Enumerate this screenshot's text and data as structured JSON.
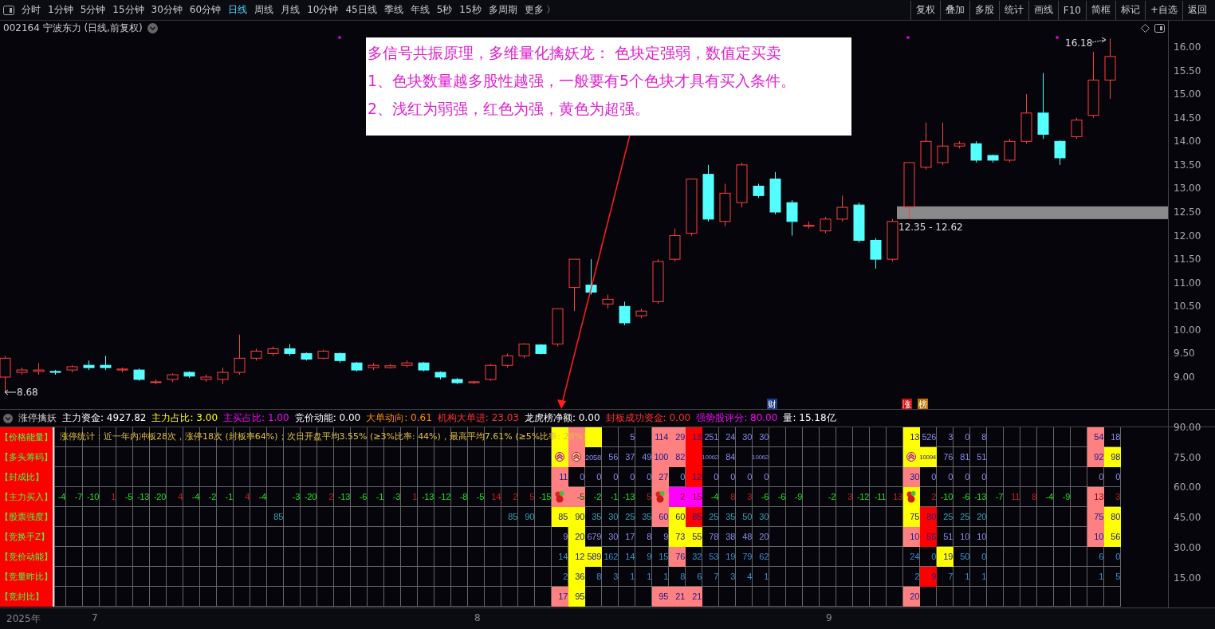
{
  "toolbar": {
    "periods": [
      {
        "label": "分时",
        "selected": false
      },
      {
        "label": "1分钟",
        "selected": false
      },
      {
        "label": "5分钟",
        "selected": false
      },
      {
        "label": "15分钟",
        "selected": false
      },
      {
        "label": "30分钟",
        "selected": false
      },
      {
        "label": "60分钟",
        "selected": false
      },
      {
        "label": "日线",
        "selected": true
      },
      {
        "label": "周线",
        "selected": false
      },
      {
        "label": "月线",
        "selected": false
      },
      {
        "label": "10分钟",
        "selected": false
      },
      {
        "label": "45日线",
        "selected": false
      },
      {
        "label": "季线",
        "selected": false
      },
      {
        "label": "年线",
        "selected": false
      },
      {
        "label": "5秒",
        "selected": false
      },
      {
        "label": "15秒",
        "selected": false
      },
      {
        "label": "多周期",
        "selected": false
      },
      {
        "label": "更多 〉",
        "selected": false
      }
    ],
    "actions": [
      "复权",
      "叠加",
      "多股",
      "统计",
      "画线",
      "F10",
      "简框",
      "标记",
      "+自选",
      "返回"
    ]
  },
  "chart": {
    "title": "002164 宁波东力 (日线,前复权)",
    "price_axis": [
      "16.00",
      "15.50",
      "15.00",
      "14.50",
      "14.00",
      "13.50",
      "13.00",
      "12.50",
      "12.00",
      "11.50",
      "11.00",
      "10.50",
      "10.00",
      "9.50",
      "9.00"
    ],
    "high_label": "16.18",
    "low_label": "8.68",
    "zone_label": "12.35 - 12.62",
    "badges": [
      {
        "text": "财",
        "color": "#1a3a8a"
      },
      {
        "text": "涨",
        "color": "#d01010"
      },
      {
        "text": "榜",
        "color": "#c07000"
      }
    ],
    "note": [
      "多信号共振原理，多维量化擒妖龙： 色块定强弱，数值定买卖",
      "1、色块数量越多股性越强，一般要有5个色块才具有买入条件。",
      "2、浅红为弱强，红色为强，黄色为超强。"
    ]
  },
  "indicator": {
    "name": "涨停擒妖",
    "values": [
      {
        "label": "主力资金:",
        "value": "4927.82",
        "color": "#ffffff"
      },
      {
        "label": "主力占比:",
        "value": "3.00",
        "color": "#ffff00"
      },
      {
        "label": "主买占比:",
        "value": "1.00",
        "color": "#ff00ff"
      },
      {
        "label": "竞价动能:",
        "value": "0.00",
        "color": "#ffffff"
      },
      {
        "label": "大单动向:",
        "value": "0.61",
        "color": "#ff8c00"
      },
      {
        "label": "机构大单进:",
        "value": "23.03",
        "color": "#ff3030"
      },
      {
        "label": "龙虎榜净额:",
        "value": "0.00",
        "color": "#ffffff"
      },
      {
        "label": "封板成功资金:",
        "value": "0.00",
        "color": "#ff3030"
      },
      {
        "label": "强势股评分:",
        "value": "80.00",
        "color": "#ff00ff"
      },
      {
        "label": "量:",
        "value": "15.18亿",
        "color": "#ffffff"
      }
    ]
  },
  "grid": {
    "summary": "涨停统计：近一年内冲板28次，涨停18次 (封板率64%)；次日开盘平均3.55% (≥3%比率: 44%)，最高平均7.61% (≥5%比率: 28%)",
    "axis": [
      "90.00",
      "75.00",
      "60.00",
      "45.00",
      "30.00",
      "15.00"
    ],
    "rows": [
      {
        "label": "【价格能量】",
        "cells": [
          null,
          null,
          null,
          null,
          null,
          null,
          null,
          null,
          null,
          null,
          null,
          null,
          null,
          null,
          null,
          null,
          null,
          null,
          null,
          null,
          null,
          null,
          null,
          null,
          null,
          null,
          null,
          null,
          null,
          null,
          {
            "color": "#ffff00"
          },
          {
            "color": "#ff8080"
          },
          {
            "color": "#ffff00"
          },
          null,
          {
            "text": "5"
          },
          null,
          {
            "text": "114",
            "color": "#ff8080"
          },
          {
            "text": "29",
            "color": "#ff8080"
          },
          {
            "text": "13",
            "color": "#ff0000"
          },
          {
            "text": "251"
          },
          {
            "text": "24"
          },
          {
            "text": "30"
          },
          {
            "text": "30"
          },
          null,
          null,
          null,
          null,
          null,
          null,
          null,
          null,
          {
            "text": "13",
            "color": "#ffff00"
          },
          {
            "text": "526"
          },
          {
            "text": "3"
          },
          {
            "text": "0"
          },
          {
            "text": "8"
          },
          null,
          null,
          null,
          null,
          null,
          null,
          {
            "text": "54",
            "color": "#ff8080"
          },
          {
            "text": "18"
          }
        ]
      },
      {
        "label": "【多头筹码】",
        "cells": [
          null,
          null,
          null,
          null,
          null,
          null,
          null,
          null,
          null,
          null,
          null,
          null,
          null,
          null,
          null,
          null,
          null,
          null,
          null,
          null,
          null,
          null,
          null,
          null,
          null,
          null,
          null,
          null,
          null,
          null,
          {
            "kind": "chevron",
            "color": "#ffff00"
          },
          {
            "kind": "chevron",
            "color": "#ff8080"
          },
          {
            "text": "2058"
          },
          {
            "text": "56"
          },
          {
            "text": "37"
          },
          {
            "text": "49"
          },
          {
            "text": "100",
            "color": "#ff8080"
          },
          {
            "text": "82",
            "color": "#ff8080"
          },
          {
            "color": "#ff0000"
          },
          {
            "text": "10062"
          },
          {
            "text": "84"
          },
          null,
          {
            "text": "10062"
          },
          null,
          null,
          null,
          null,
          null,
          null,
          null,
          null,
          {
            "kind": "chevron",
            "color": "#ffff00"
          },
          {
            "text": "10094",
            "color": "#ffff00"
          },
          {
            "text": "76"
          },
          {
            "text": "81"
          },
          {
            "text": "51"
          },
          null,
          null,
          null,
          null,
          null,
          null,
          {
            "text": "92",
            "color": "#ff8080"
          },
          {
            "text": "98",
            "color": "#ffff00"
          }
        ]
      },
      {
        "label": "【封成比】",
        "cells": [
          null,
          null,
          null,
          null,
          null,
          null,
          null,
          null,
          null,
          null,
          null,
          null,
          null,
          null,
          null,
          null,
          null,
          null,
          null,
          null,
          null,
          null,
          null,
          null,
          null,
          null,
          null,
          null,
          null,
          null,
          {
            "text": "11",
            "color": "#ff8080"
          },
          {
            "text": "0"
          },
          {
            "text": "0"
          },
          {
            "text": "0"
          },
          {
            "text": "0"
          },
          {
            "text": "0"
          },
          {
            "text": "27",
            "color": "#ff8080"
          },
          {
            "text": "0"
          },
          {
            "text": "12",
            "color": "#ff0000"
          },
          {
            "text": "0"
          },
          {
            "text": "0"
          },
          {
            "text": "0"
          },
          {
            "text": "0"
          },
          null,
          null,
          null,
          null,
          null,
          null,
          null,
          null,
          {
            "text": "30",
            "color": "#ff8080"
          },
          {
            "text": "0"
          },
          {
            "text": "0"
          },
          {
            "text": "0"
          },
          {
            "text": "0"
          },
          null,
          null,
          null,
          null,
          null,
          null,
          {
            "text": "0"
          },
          {
            "text": "0"
          }
        ]
      },
      {
        "label": "【主力买入】",
        "cells": [
          {
            "text": "-4",
            "kind": "fall"
          },
          {
            "text": "-7",
            "kind": "fall"
          },
          {
            "text": "-10",
            "kind": "fall"
          },
          {
            "text": "1",
            "kind": "rise"
          },
          {
            "text": "-5",
            "kind": "fall"
          },
          {
            "text": "-13",
            "kind": "fall"
          },
          {
            "text": "-20",
            "kind": "fall"
          },
          {
            "text": "4",
            "kind": "rise"
          },
          {
            "text": "-4",
            "kind": "fall"
          },
          {
            "text": "-2",
            "kind": "fall"
          },
          {
            "text": "-1",
            "kind": "fall"
          },
          {
            "text": "4",
            "kind": "rise"
          },
          {
            "text": "-4",
            "kind": "fall"
          },
          null,
          {
            "text": "-3",
            "kind": "fall"
          },
          {
            "text": "-20",
            "kind": "fall"
          },
          {
            "text": "2",
            "kind": "rise"
          },
          {
            "text": "-13",
            "kind": "fall"
          },
          {
            "text": "-6",
            "kind": "fall"
          },
          {
            "text": "-1",
            "kind": "fall"
          },
          {
            "text": "-3",
            "kind": "fall"
          },
          {
            "text": "1",
            "kind": "rise"
          },
          {
            "text": "-13",
            "kind": "fall"
          },
          {
            "text": "-12",
            "kind": "fall"
          },
          {
            "text": "-8",
            "kind": "fall"
          },
          {
            "text": "-5",
            "kind": "fall"
          },
          {
            "text": "14",
            "kind": "rise"
          },
          {
            "text": "2",
            "kind": "rise"
          },
          {
            "text": "5",
            "kind": "rise"
          },
          {
            "text": "-15",
            "kind": "fall"
          },
          {
            "kind": "fruit",
            "color": "#ff8080"
          },
          {
            "text": "-5",
            "kind": "fall",
            "color": "#ff8080"
          },
          {
            "text": "-2",
            "kind": "fall"
          },
          {
            "text": "-1",
            "kind": "fall"
          },
          {
            "text": "-13",
            "kind": "fall"
          },
          {
            "text": "5",
            "kind": "rise"
          },
          {
            "kind": "fruit",
            "color": "#ff8080"
          },
          {
            "text": "2",
            "kind": "rise",
            "color": "#ff00ff"
          },
          {
            "text": "15",
            "kind": "rise",
            "color": "#ff00ff"
          },
          {
            "text": "-4",
            "kind": "fall"
          },
          {
            "text": "8",
            "kind": "rise"
          },
          {
            "text": "3",
            "kind": "rise"
          },
          {
            "text": "-6",
            "kind": "fall"
          },
          {
            "text": "-6",
            "kind": "fall"
          },
          {
            "text": "-9",
            "kind": "fall"
          },
          null,
          {
            "text": "-2",
            "kind": "fall"
          },
          {
            "text": "3",
            "kind": "rise"
          },
          {
            "text": "-12",
            "kind": "fall"
          },
          {
            "text": "-11",
            "kind": "fall"
          },
          {
            "text": "13",
            "kind": "rise"
          },
          {
            "kind": "fruit",
            "color": "#ffff00"
          },
          {
            "text": "2",
            "kind": "rise"
          },
          {
            "text": "-10",
            "kind": "fall"
          },
          {
            "text": "-6",
            "kind": "fall"
          },
          {
            "text": "-13",
            "kind": "fall"
          },
          {
            "text": "-7",
            "kind": "fall"
          },
          {
            "text": "11",
            "kind": "rise"
          },
          {
            "text": "8",
            "kind": "rise"
          },
          {
            "text": "-4",
            "kind": "fall"
          },
          {
            "text": "-9",
            "kind": "fall"
          },
          null,
          {
            "text": "13",
            "kind": "rise",
            "color": "#ff8080"
          },
          {
            "text": "3",
            "kind": "rise"
          }
        ]
      },
      {
        "label": "【股票强度】",
        "cells": [
          null,
          null,
          null,
          null,
          null,
          null,
          null,
          null,
          null,
          null,
          null,
          null,
          null,
          {
            "text": "85"
          },
          null,
          null,
          null,
          null,
          null,
          null,
          null,
          null,
          null,
          null,
          null,
          null,
          null,
          {
            "text": "85"
          },
          {
            "text": "90"
          },
          null,
          {
            "text": "85",
            "color": "#ffff00"
          },
          {
            "text": "90",
            "color": "#ffff00"
          },
          {
            "text": "35"
          },
          {
            "text": "30"
          },
          {
            "text": "25"
          },
          {
            "text": "35"
          },
          {
            "text": "60",
            "color": "#ff8080"
          },
          {
            "text": "60",
            "color": "#ffff00"
          },
          {
            "text": "85",
            "color": "#ff0000"
          },
          {
            "text": "25"
          },
          {
            "text": "35"
          },
          {
            "text": "50"
          },
          {
            "text": "30"
          },
          null,
          null,
          null,
          null,
          null,
          null,
          null,
          null,
          {
            "text": "75",
            "color": "#ffff00"
          },
          {
            "text": "80",
            "color": "#ff0000"
          },
          {
            "text": "25"
          },
          {
            "text": "25"
          },
          {
            "text": "20"
          },
          null,
          null,
          null,
          null,
          null,
          null,
          {
            "text": "75",
            "color": "#ff8080"
          },
          {
            "text": "80",
            "color": "#ffff00"
          }
        ]
      },
      {
        "label": "【竞换手Z】",
        "cells": [
          null,
          null,
          null,
          null,
          null,
          null,
          null,
          null,
          null,
          null,
          null,
          null,
          null,
          null,
          null,
          null,
          null,
          null,
          null,
          null,
          null,
          null,
          null,
          null,
          null,
          null,
          null,
          null,
          null,
          null,
          {
            "text": "9"
          },
          {
            "text": "20",
            "color": "#ffff00"
          },
          {
            "text": "679"
          },
          {
            "text": "30"
          },
          {
            "text": "17"
          },
          {
            "text": "8"
          },
          {
            "text": "9"
          },
          {
            "text": "73",
            "color": "#ffff00"
          },
          {
            "text": "55",
            "color": "#ffff00"
          },
          {
            "text": "78"
          },
          {
            "text": "38"
          },
          {
            "text": "48"
          },
          {
            "text": "20"
          },
          null,
          null,
          null,
          null,
          null,
          null,
          null,
          null,
          {
            "text": "10",
            "color": "#ff8080"
          },
          {
            "text": "56",
            "color": "#ff0000"
          },
          {
            "text": "51"
          },
          {
            "text": "10"
          },
          {
            "text": "10"
          },
          null,
          null,
          null,
          null,
          null,
          null,
          {
            "text": "10",
            "color": "#ff8080"
          },
          {
            "text": "56",
            "color": "#ffff00"
          }
        ]
      },
      {
        "label": "【竞价动能】",
        "cells": [
          null,
          null,
          null,
          null,
          null,
          null,
          null,
          null,
          null,
          null,
          null,
          null,
          null,
          null,
          null,
          null,
          null,
          null,
          null,
          null,
          null,
          null,
          null,
          null,
          null,
          null,
          null,
          null,
          null,
          null,
          {
            "text": "14"
          },
          {
            "text": "12",
            "color": "#ffff00"
          },
          {
            "text": "589",
            "color": "#ffff00"
          },
          {
            "text": "162"
          },
          {
            "text": "14"
          },
          {
            "text": "9"
          },
          {
            "text": "15"
          },
          {
            "text": "76",
            "color": "#ff8080"
          },
          {
            "text": "32"
          },
          {
            "text": "53"
          },
          {
            "text": "19"
          },
          {
            "text": "79"
          },
          {
            "text": "62"
          },
          null,
          null,
          null,
          null,
          null,
          null,
          null,
          null,
          {
            "text": "24"
          },
          {
            "text": "0"
          },
          {
            "text": "19",
            "color": "#ffff00"
          },
          {
            "text": "50"
          },
          {
            "text": "0"
          },
          null,
          null,
          null,
          null,
          null,
          null,
          {
            "text": "6"
          },
          {
            "text": "0"
          }
        ]
      },
      {
        "label": "【竞量昨比】",
        "cells": [
          null,
          null,
          null,
          null,
          null,
          null,
          null,
          null,
          null,
          null,
          null,
          null,
          null,
          null,
          null,
          null,
          null,
          null,
          null,
          null,
          null,
          null,
          null,
          null,
          null,
          null,
          null,
          null,
          null,
          null,
          {
            "text": "2"
          },
          {
            "text": "36",
            "color": "#ffff00"
          },
          {
            "text": "8"
          },
          {
            "text": "3"
          },
          {
            "text": "1"
          },
          {
            "text": "1"
          },
          {
            "text": "1"
          },
          {
            "text": "8"
          },
          {
            "text": "6"
          },
          {
            "text": "7"
          },
          {
            "text": "3"
          },
          {
            "text": "4"
          },
          {
            "text": "1"
          },
          null,
          null,
          null,
          null,
          null,
          null,
          null,
          null,
          {
            "text": "2"
          },
          {
            "text": "9",
            "color": "#ff0000"
          },
          {
            "text": "7"
          },
          {
            "text": "1"
          },
          {
            "text": "1"
          },
          null,
          null,
          null,
          null,
          null,
          null,
          {
            "text": "1"
          },
          {
            "text": "5"
          }
        ]
      },
      {
        "label": "【竞封比】",
        "cells": [
          null,
          null,
          null,
          null,
          null,
          null,
          null,
          null,
          null,
          null,
          null,
          null,
          null,
          null,
          null,
          null,
          null,
          null,
          null,
          null,
          null,
          null,
          null,
          null,
          null,
          null,
          null,
          null,
          null,
          null,
          {
            "text": "17",
            "color": "#ff8080"
          },
          {
            "text": "95",
            "color": "#ffff00"
          },
          null,
          null,
          null,
          null,
          {
            "text": "95",
            "color": "#ff8080"
          },
          {
            "text": "21",
            "color": "#ff8080"
          },
          {
            "text": "21",
            "color": "#ff8080"
          },
          null,
          null,
          null,
          null,
          null,
          null,
          null,
          null,
          null,
          null,
          null,
          null,
          {
            "text": "20",
            "color": "#ff8080"
          },
          null,
          null,
          null,
          null,
          null,
          null,
          null,
          null,
          null,
          null,
          null,
          null
        ]
      }
    ]
  },
  "date_axis": [
    "2025年",
    "7",
    "8",
    "9"
  ]
}
